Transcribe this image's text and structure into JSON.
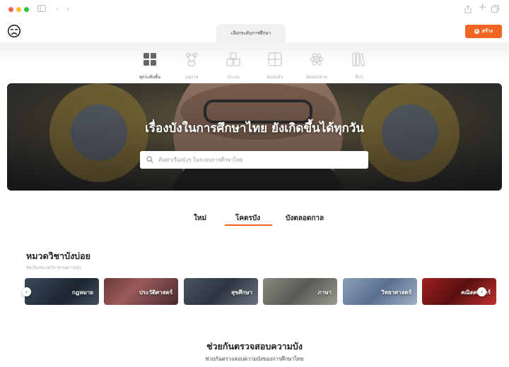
{
  "header": {
    "level_tab": "เลือกระดับการศึกษา",
    "create_label": "สร้าง"
  },
  "categories": [
    {
      "label": "ทุกระดับชั้น",
      "icon": "grid-icon",
      "active": true
    },
    {
      "label": "อนุบาล",
      "icon": "teddy-bear-icon",
      "active": false
    },
    {
      "label": "ประถม",
      "icon": "abc-blocks-icon",
      "active": false
    },
    {
      "label": "มัธยมต้น",
      "icon": "calculator-icon",
      "active": false
    },
    {
      "label": "มัธยมปลาย",
      "icon": "atom-icon",
      "active": false
    },
    {
      "label": "อื่นๆ",
      "icon": "books-icon",
      "active": false
    }
  ],
  "hero": {
    "title": "เรื่องบังในการศึกษาไทย ยังเกิดขึ้นได้ทุกวัน",
    "search_placeholder": "ค้นหาเรื่องบังๆ ในระบบการศึกษาไทย"
  },
  "tabs": [
    {
      "label": "ใหม่",
      "active": false
    },
    {
      "label": "โคตรบัง",
      "active": true
    },
    {
      "label": "บังตลอดกาล",
      "active": false
    }
  ],
  "subjects": {
    "title": "หมวดวิชาบังบ่อย",
    "subtitle": "จัดเรียงหมวดวิชาตามความบัง",
    "items": [
      {
        "label": "กฎหมาย"
      },
      {
        "label": "ประวัติศาสตร์"
      },
      {
        "label": "สุขศึกษา"
      },
      {
        "label": "ภาษา"
      },
      {
        "label": "วิทยาศาสตร์"
      },
      {
        "label": "คณิตศาสตร์"
      }
    ]
  },
  "help": {
    "title": "ช่วยกันตรวจสอบความบัง",
    "subtitle": "ช่วยกันตรวจสอบความบังของการศึกษาไทย"
  },
  "colors": {
    "accent": "#f26522"
  }
}
